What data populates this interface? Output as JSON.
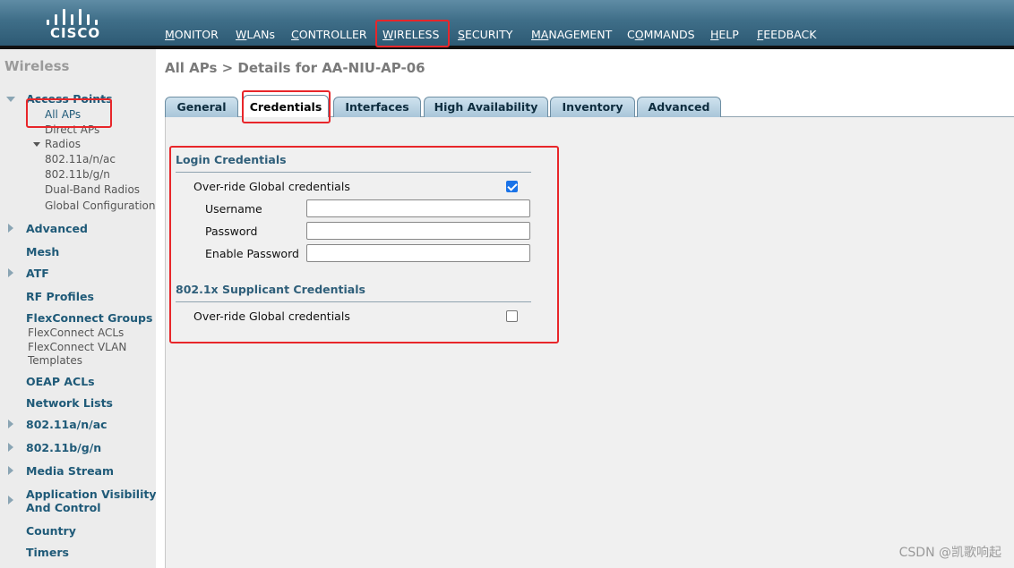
{
  "brand": {
    "logo_text": "CISCO"
  },
  "nav": {
    "items": [
      {
        "label": "MONITOR",
        "ul": "M",
        "rest": "ONITOR"
      },
      {
        "label": "WLANs",
        "ul": "W",
        "rest": "LANs"
      },
      {
        "label": "CONTROLLER",
        "ul": "C",
        "rest": "ONTROLLER"
      },
      {
        "label": "WIRELESS",
        "ul": "W",
        "rest": "IRELESS"
      },
      {
        "label": "SECURITY",
        "ul": "S",
        "rest": "ECURITY"
      },
      {
        "label": "MANAGEMENT",
        "ul": "MA",
        "rest": "NAGEMENT",
        "split": true
      },
      {
        "label": "COMMANDS",
        "ul": "O",
        "pre": "C",
        "rest": "MMANDS"
      },
      {
        "label": "HELP",
        "ul": "H",
        "rest": "ELP"
      },
      {
        "label": "FEEDBACK",
        "ul": "F",
        "rest": "EEDBACK"
      }
    ],
    "active": "WIRELESS"
  },
  "sidebar": {
    "title": "Wireless",
    "access_points": "Access Points",
    "all_aps": "All APs",
    "direct_aps": "Direct APs",
    "radios": "Radios",
    "radio_items": [
      "802.11a/n/ac",
      "802.11b/g/n",
      "Dual-Band Radios",
      "Global Configuration"
    ],
    "advanced": "Advanced",
    "mesh": "Mesh",
    "atf": "ATF",
    "rf_profiles": "RF Profiles",
    "flexconnect_groups": "FlexConnect Groups",
    "flexconnect_acls": "FlexConnect ACLs",
    "flexconnect_vlan_1": "FlexConnect VLAN",
    "flexconnect_vlan_2": "Templates",
    "oeap_acls": "OEAP ACLs",
    "network_lists": "Network Lists",
    "band_a": "802.11a/n/ac",
    "band_b": "802.11b/g/n",
    "media_stream": "Media Stream",
    "app_vis_1": "Application Visibility",
    "app_vis_2": "And Control",
    "country": "Country",
    "timers": "Timers"
  },
  "main": {
    "breadcrumb": "All APs > Details for AA-NIU-AP-06",
    "tabs": [
      "General",
      "Credentials",
      "Interfaces",
      "High Availability",
      "Inventory",
      "Advanced"
    ],
    "active_tab": "Credentials",
    "login": {
      "title": "Login Credentials",
      "override_label": "Over-ride Global credentials",
      "override_checked": true,
      "username_label": "Username",
      "username_value": "",
      "password_label": "Password",
      "password_value": "",
      "enable_password_label": "Enable Password",
      "enable_password_value": ""
    },
    "dot1x": {
      "title": "802.1x Supplicant Credentials",
      "override_label": "Over-ride Global credentials",
      "override_checked": false
    }
  },
  "watermark": "CSDN @凯歌响起",
  "colors": {
    "highlight": "#e8262a",
    "link": "#1f5a78",
    "checkbox": "#1a73e8"
  }
}
